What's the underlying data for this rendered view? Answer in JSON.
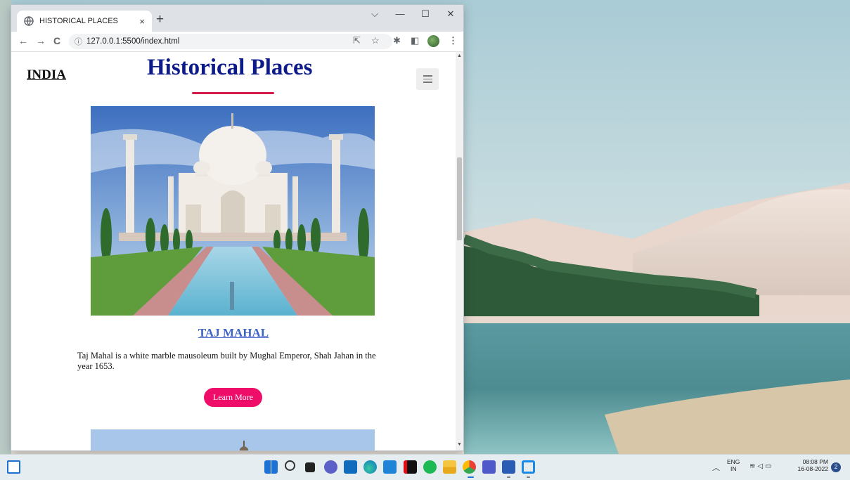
{
  "browser": {
    "tab_title": "HISTORICAL PLACES",
    "tab_close": "×",
    "new_tab": "+",
    "url": "127.0.0.1:5500/index.html",
    "controls": {
      "dropdown": "⌵",
      "minimize": "—",
      "maximize": "☐",
      "close": "✕"
    },
    "nav": {
      "back": "←",
      "forward": "→",
      "reload": "C"
    },
    "icons": [
      "share-icon",
      "star-icon",
      "extensions-icon",
      "sidepanel-icon",
      "profile-avatar",
      "menu-dots-icon"
    ]
  },
  "page": {
    "brand": "INDIA",
    "title": "Historical Places",
    "card": {
      "title": "TAJ MAHAL",
      "description": "Taj Mahal is a white marble mausoleum built by Mughal Emperor, Shah Jahan in the year 1653.",
      "button": "Learn More"
    },
    "colors": {
      "title": "#0c1a8a",
      "underline": "#d41b4a",
      "button": "#ee0e69",
      "card_title": "#3f64c8"
    }
  },
  "taskbar": {
    "lang_top": "ENG",
    "lang_bottom": "IN",
    "time": "08:08 PM",
    "date": "16-08-2022",
    "notification_count": "2",
    "apps": [
      "widgets-icon",
      "start-icon",
      "search-icon",
      "task-view-icon",
      "chat-icon",
      "mail-icon",
      "edge-icon",
      "store-icon",
      "netflix-icon",
      "spotify-icon",
      "file-explorer-icon",
      "chrome-icon",
      "teams-icon",
      "word-icon",
      "vscode-icon"
    ]
  }
}
